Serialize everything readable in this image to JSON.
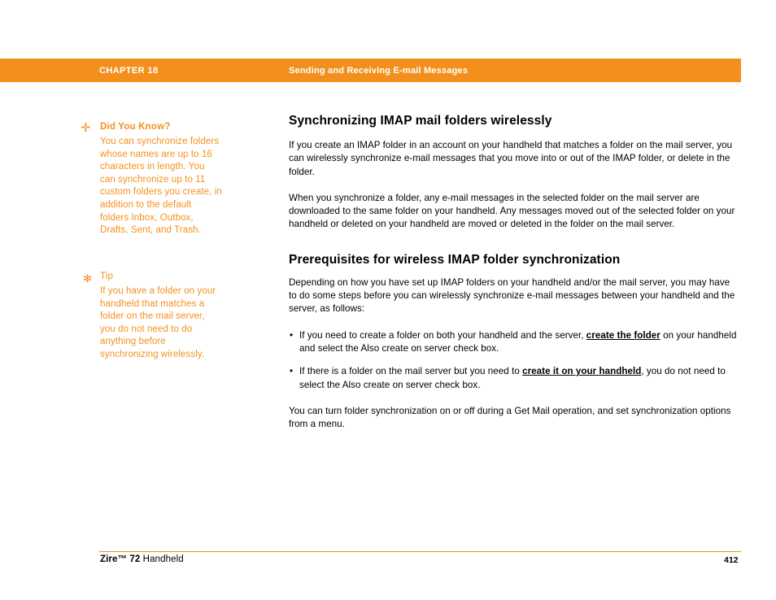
{
  "header": {
    "chapter_label": "CHAPTER 18",
    "title": "Sending and Receiving E-mail Messages",
    "bar_color": "#F3901D"
  },
  "notes": [
    {
      "icon": "plus-icon",
      "icon_glyph": "✛",
      "heading": "Did You Know?",
      "body": "You can synchronize folders whose names are up to 16 characters in length. You can synchronize up to 11 custom folders you create, in addition to the default folders Inbox, Outbox, Drafts, Sent, and Trash."
    },
    {
      "icon": "asterisk-icon",
      "icon_glyph": "✻",
      "heading": "Tip",
      "body": "If you have a folder on your handheld that matches a folder on the mail server, you do not need to do anything before synchronizing wirelessly."
    }
  ],
  "main": {
    "section1_title": "Synchronizing IMAP mail folders wirelessly",
    "section1_para1": "If you create an IMAP folder in an account on your handheld that matches a folder on the mail server, you can wirelessly synchronize e-mail messages that you move into or out of the IMAP folder, or delete in the folder.",
    "section1_para2": "When you synchronize a folder, any e-mail messages in the selected folder on the mail server are downloaded to the same folder on your handheld. Any messages moved out of the selected folder on your handheld or deleted on your handheld are moved or deleted in the folder on the mail server.",
    "section2_title": "Prerequisites for wireless IMAP folder synchronization",
    "section2_para1": "Depending on how you have set up IMAP folders on your handheld and/or the mail server, you may have to do some steps before you can wirelessly synchronize e-mail messages between your handheld and the server, as follows:",
    "bullet1_before": "If you need to create a folder on both your handheld and the server, ",
    "bullet1_link": "create the folder",
    "bullet1_after": " on your handheld and select the Also create on server check box.",
    "bullet2_before": "If there is a folder on the mail server but you need to ",
    "bullet2_link": "create it on your handheld",
    "bullet2_after": ", you do not need to select the Also create on server check box.",
    "section2_para2": "You can turn folder synchronization on or off during a Get Mail operation, and set synchronization options from a menu."
  },
  "footer": {
    "product_bold": "Zire™ 72",
    "product_light": " Handheld",
    "page_number": "412",
    "rule_color": "#F3901D"
  }
}
